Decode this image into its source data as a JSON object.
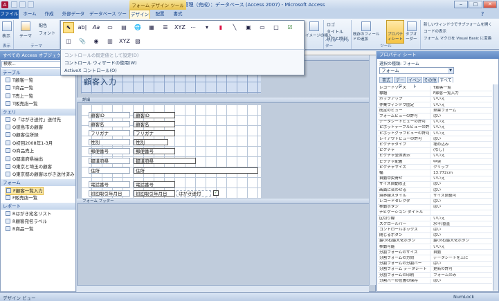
{
  "window": {
    "title": "顧客管理（完成）：データベース (Access 2007) - Microsoft Access",
    "context_tab": "フォーム デザイン ツール",
    "app_icon": "A"
  },
  "tabs": [
    {
      "label": "ファイル"
    },
    {
      "label": "ホーム"
    },
    {
      "label": "作成"
    },
    {
      "label": "外部データ"
    },
    {
      "label": "データベース ツール"
    },
    {
      "label": "デザイン"
    },
    {
      "label": "配置"
    },
    {
      "label": "書式"
    }
  ],
  "ribbon": {
    "view_label": "表示",
    "theme_label": "テーマ",
    "color_label": "配色",
    "font_label": "フォント",
    "view_group": "表示",
    "theme_group": "テーマ",
    "insert_image_label": "イメージの挿入",
    "logo_label": "ロゴ",
    "title_label": "タイトル",
    "datetime_label": "日付と時刻",
    "header_group": "ヘッダー/フッター",
    "add_fields_label": "既存のフィールドの追加",
    "property_sheet_label": "プロパティシート",
    "tab_order_label": "タブオーダー",
    "tools_group": "ツール",
    "new_window_label": "新しいウィンドウでサブフォームを開く",
    "view_code_label": "コードの表示",
    "convert_macro_label": "フォーム マクロを Visual Basic に変換"
  },
  "gallery_menu": {
    "set_default": "コントロールの既定値として設定(D)",
    "use_wizard": "コントロール ウィザードの使用(W)",
    "activex": "ActiveX コントロール(O)"
  },
  "nav": {
    "header": "すべての Access オブジェクト",
    "search_placeholder": "検索...",
    "groups": [
      {
        "label": "テーブル",
        "items": [
          "T顧客一覧",
          "T商品一覧",
          "T売上一覧",
          "T販売店一覧"
        ]
      },
      {
        "label": "クエリ",
        "items": [
          "Q「はがき送付」送付先",
          "Q徳島市の顧客",
          "Q顧客住所録",
          "Q初回2008年1-3月",
          "Q商品売上",
          "Q都道府県抽出",
          "Q東京と埼玉の顧客",
          "Q東京都の顧客はがき送付済み"
        ]
      },
      {
        "label": "フォーム",
        "items": [
          "F顧客一覧入力",
          "F販売店一覧"
        ]
      },
      {
        "label": "レポート",
        "items": [
          "Rはがき宛名リスト",
          "R顧客宛名ラベル",
          "R商品一覧"
        ]
      }
    ]
  },
  "form": {
    "title": "顧客入力",
    "detail_section": "詳細",
    "footer_section": "フォーム フッター",
    "fields": [
      {
        "label": "顧客ID",
        "control": "顧客ID"
      },
      {
        "label": "顧客名",
        "control": "顧客名"
      },
      {
        "label": "フリガナ",
        "control": "フリガナ"
      },
      {
        "label": "性別",
        "control": "性別"
      },
      {
        "label": "郵便番号",
        "control": "郵便番号"
      },
      {
        "label": "都道府県",
        "control": "都道府県"
      },
      {
        "label": "住所",
        "control": "住所"
      },
      {
        "label": "電話番号",
        "control": "電話番号"
      },
      {
        "label": "初回取引年月日",
        "control": "初回取引年月日"
      }
    ],
    "checkbox_label": "はがき送付"
  },
  "property_sheet": {
    "header": "プロパティ シート",
    "selection_label": "選択の種類: フォーム",
    "selected_object": "フォーム",
    "tabs": [
      "書式",
      "データ",
      "イベント",
      "その他",
      "すべて"
    ],
    "rows": [
      [
        "レコードソース",
        "T顧客一覧"
      ],
      [
        "標題",
        "F顧客一覧入力"
      ],
      [
        "ポップアップ",
        "いいえ"
      ],
      [
        "作業ウィンドウ固定",
        "いいえ"
      ],
      [
        "既定のビュー",
        "単票フォーム"
      ],
      [
        "フォームビューの許可",
        "はい"
      ],
      [
        "データシートビューの許可",
        "いいえ"
      ],
      [
        "ピボットテーブルビューの許可",
        "いいえ"
      ],
      [
        "ピボットグラフビューの許可",
        "いいえ"
      ],
      [
        "レイアウトビューの許可",
        "はい"
      ],
      [
        "ピクチャタイプ",
        "埋め込み"
      ],
      [
        "ピクチャ",
        "(なし)"
      ],
      [
        "ピクチャ全体表示",
        "いいえ"
      ],
      [
        "ピクチャ配置",
        "中央"
      ],
      [
        "ピクチャサイズ",
        "クリップ"
      ],
      [
        "幅",
        "13.772cm"
      ],
      [
        "自動中央寄せ",
        "いいえ"
      ],
      [
        "サイズ自動修正",
        "はい"
      ],
      [
        "画面に合わせる",
        "はい"
      ],
      [
        "境界線スタイル",
        "サイズ調整可"
      ],
      [
        "レコードセレクタ",
        "はい"
      ],
      [
        "移動ボタン",
        "はい"
      ],
      [
        "ナビゲーション タイトル",
        ""
      ],
      [
        "区切り線",
        "いいえ"
      ],
      [
        "スクロールバー",
        "水平/垂直"
      ],
      [
        "コントロールボックス",
        "はい"
      ],
      [
        "閉じるボタン",
        "はい"
      ],
      [
        "最小化/最大化ボタン",
        "最小化/最大化ボタン"
      ],
      [
        "移動可能",
        "いいえ"
      ],
      [
        "分割フォームのサイズ",
        "自動"
      ],
      [
        "分割フォームの方向",
        "データシートを上に"
      ],
      [
        "分割フォームの分割バー",
        "はい"
      ],
      [
        "分割フォーム データシート",
        "更新の許可"
      ],
      [
        "分割フォームの印刷",
        "フォームのみ"
      ],
      [
        "分割バーの位置の保存",
        "はい"
      ]
    ]
  },
  "status": {
    "left": "デザイン ビュー",
    "right": "NumLock"
  }
}
